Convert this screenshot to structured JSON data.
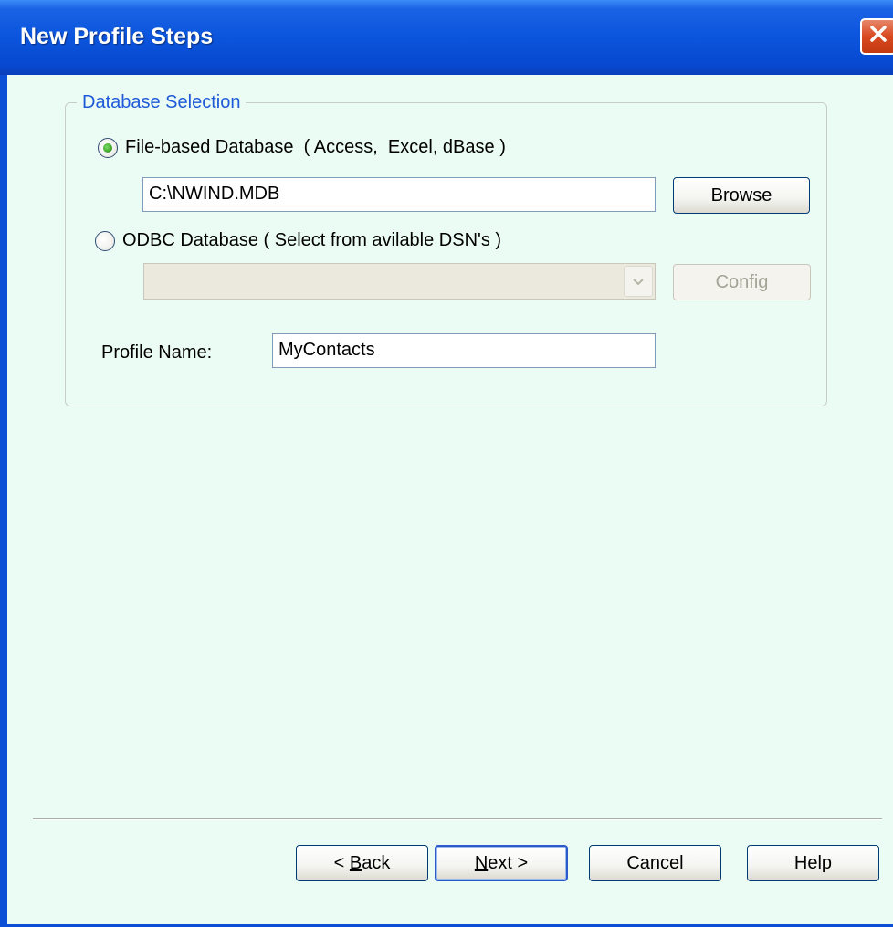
{
  "window": {
    "title": "New Profile Steps",
    "close_icon": "close-icon"
  },
  "database_selection": {
    "legend": "Database Selection",
    "file_option": {
      "label": "File-based Database  ( Access,  Excel, dBase )",
      "selected": true
    },
    "file_path": "C:\\NWIND.MDB",
    "browse_label": "Browse",
    "odbc_option": {
      "label": "ODBC Database ( Select from avilable DSN's )",
      "selected": false
    },
    "dsn_value": "",
    "config_label": "Config",
    "profile_name_label": "Profile Name:",
    "profile_name_value": "MyContacts"
  },
  "footer": {
    "back": {
      "accel": "B",
      "rest": "ack",
      "prefix": "< "
    },
    "next": {
      "accel": "N",
      "rest": "ext >"
    },
    "cancel_label": "Cancel",
    "help_label": "Help"
  },
  "colors": {
    "titlebar": "#0a55dc",
    "dialog_bg": "#ebfcf4",
    "legend_text": "#1e5ad8",
    "close_button": "#d9481f",
    "radio_dot": "#3ea82a"
  }
}
